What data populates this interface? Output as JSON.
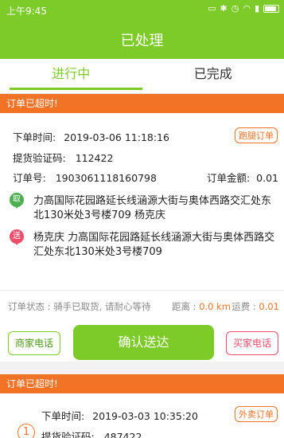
{
  "status_bar": {
    "time": "上午9:45"
  },
  "header": {
    "title": "已处理"
  },
  "tabs": [
    {
      "label": "进行中",
      "active": true
    },
    {
      "label": "已完成",
      "active": false
    }
  ],
  "orders": [
    {
      "banner": "订单已超时!",
      "order_time_label": "下单时间:",
      "order_time": "2019-03-06 11:18:16",
      "type_tag": "跑腿订单",
      "verify_label": "提货验证码:",
      "verify_code": "112422",
      "order_no_label": "订单号:",
      "order_no": "1903061118160798",
      "amount_label": "订单金额:",
      "amount": "0.01",
      "pickup_pin": "取",
      "pickup_address": "力高国际花园路延长线涵源大街与奥体西路交汇处东北130米处3号楼709 杨克庆",
      "deliver_pin": "送",
      "deliver_address": "杨克庆 力高国际花园路延长线涵源大街与奥体西路交汇处东北130米处3号楼709",
      "status_label": "订单状态 :",
      "status_text": "骑手已取货, 请耐心等待",
      "distance_label": "距离 :",
      "distance": "0.0 km",
      "fee_label": "运费 :",
      "fee": "0.01",
      "merchant_call": "商家电话",
      "confirm": "确认送达",
      "buyer_call": "买家电话"
    },
    {
      "banner": "订单已超时!",
      "index": "1",
      "order_time_label": "下单时间:",
      "order_time": "2019-03-03 10:35:20",
      "type_tag": "外卖订单",
      "verify_label": "提货验证码:",
      "verify_code": "487422"
    }
  ],
  "colors": {
    "primary": "#7ccb28",
    "warning": "#f27326",
    "danger": "#f04e6a"
  }
}
